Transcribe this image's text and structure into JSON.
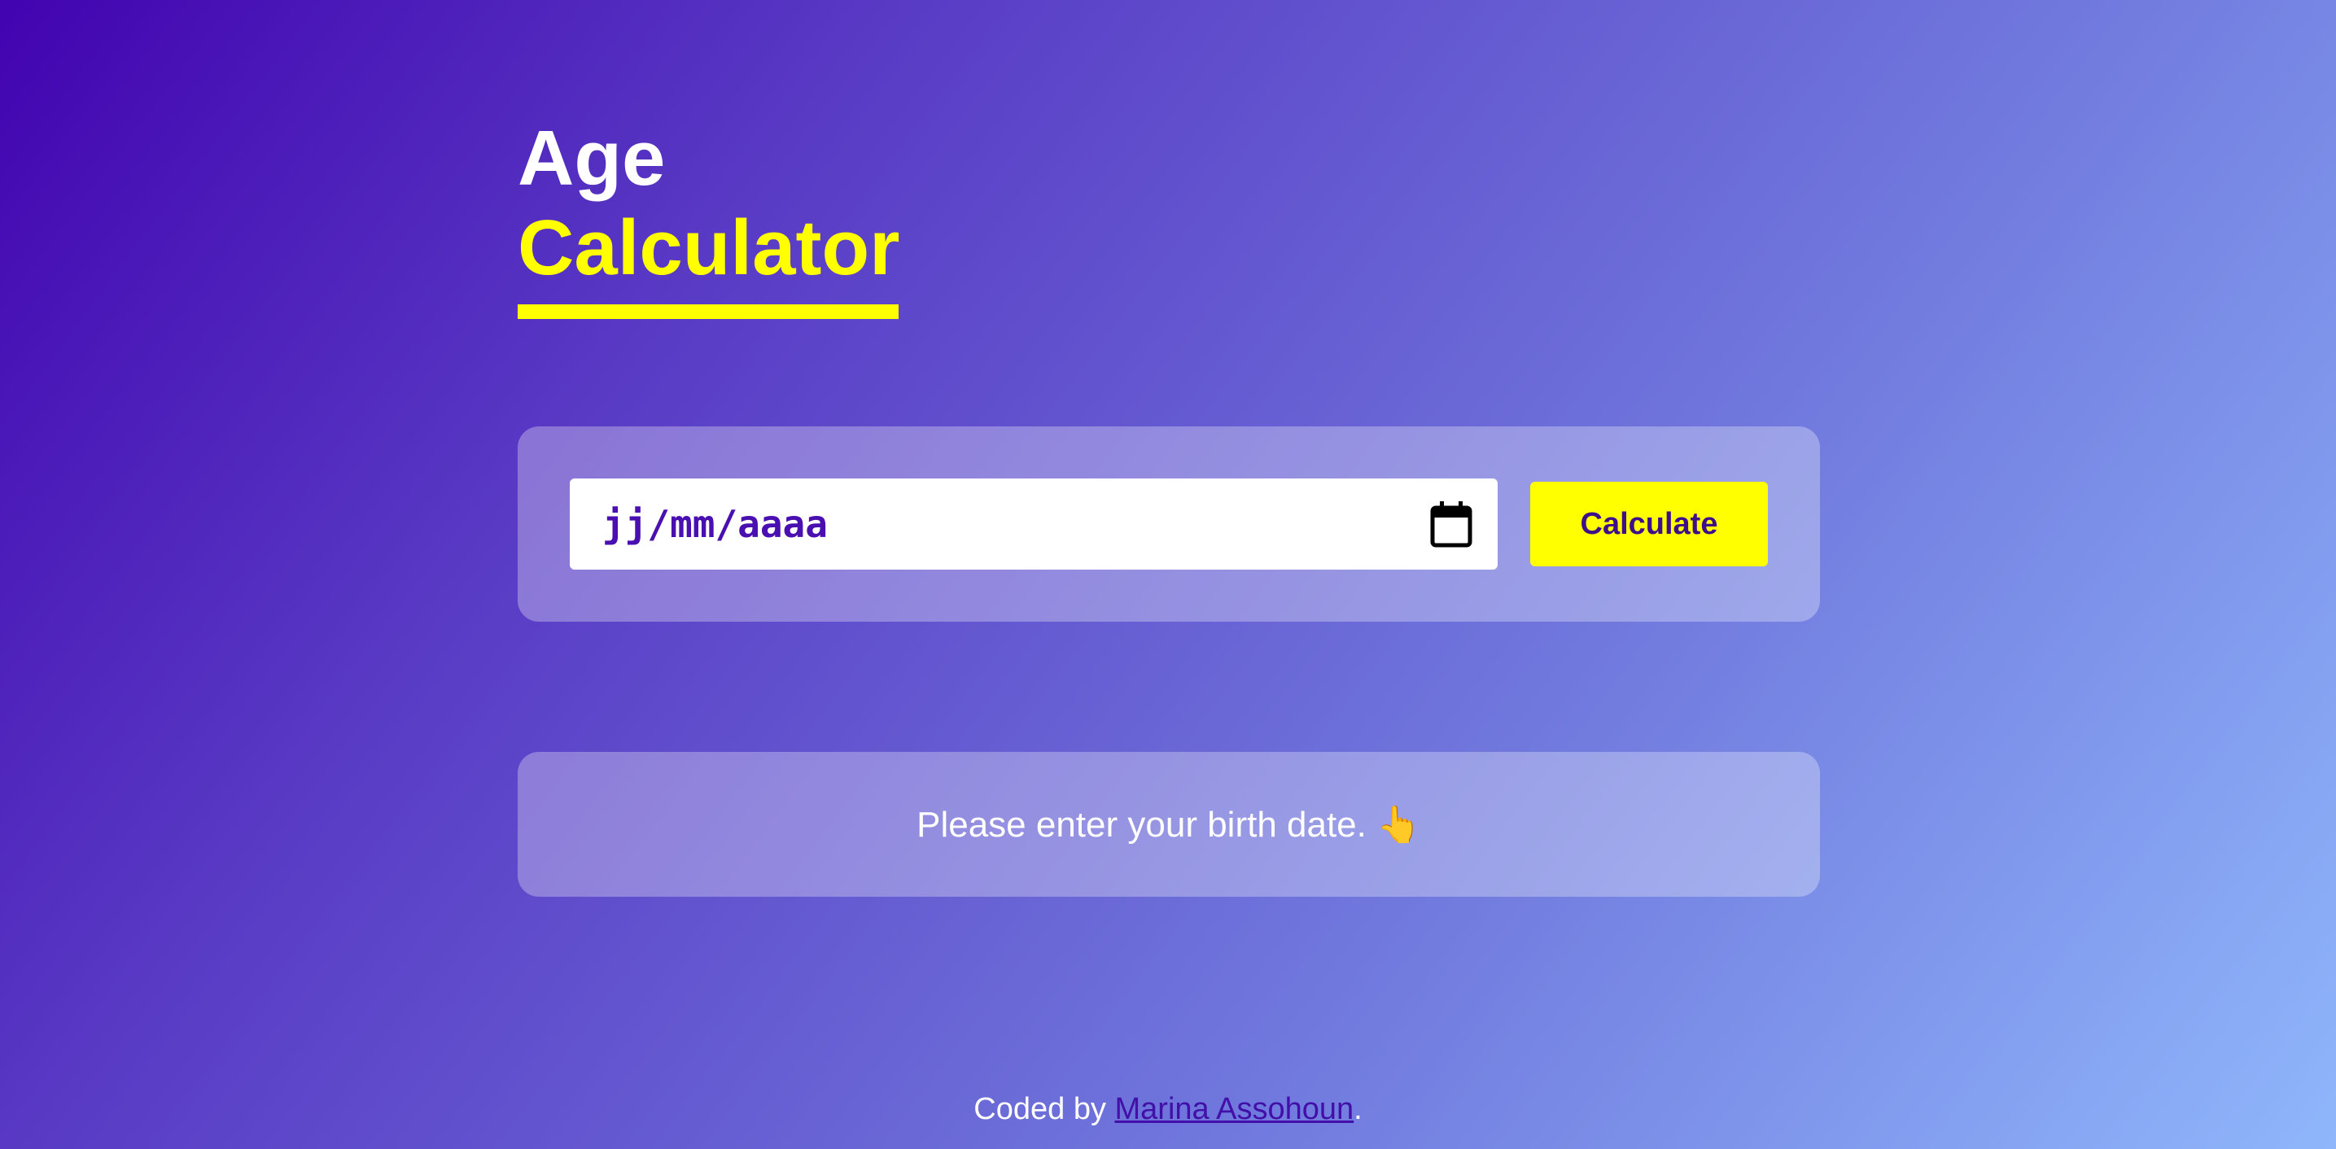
{
  "title": {
    "line1": "Age",
    "line2": "Calculator"
  },
  "form": {
    "date_placeholder": "jj/mm/aaaa",
    "calendar_icon": "calendar-icon",
    "button_label": "Calculate"
  },
  "result": {
    "message": "Please enter your birth date. 👆"
  },
  "footer": {
    "prefix": "Coded by ",
    "author": "Marina Assohoun",
    "suffix": "."
  },
  "colors": {
    "accent": "#ffff00",
    "primary": "#4203b0",
    "text": "#ffffff"
  }
}
